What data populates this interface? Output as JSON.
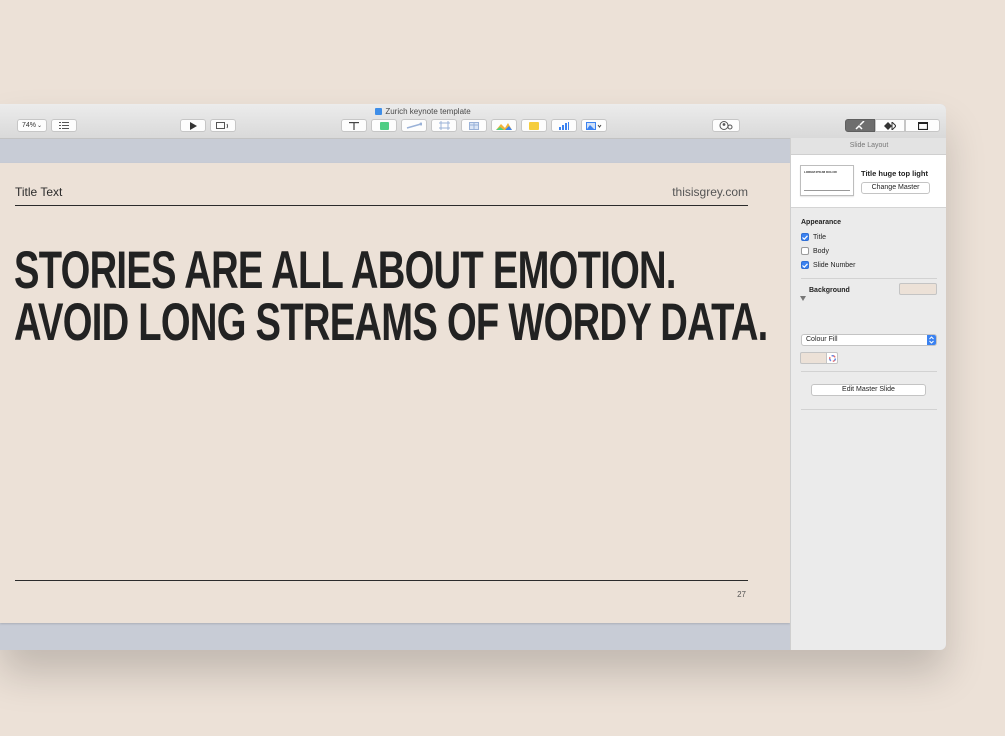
{
  "window": {
    "doc_title": "Zurich keynote template"
  },
  "toolbar": {
    "zoom_value": "74%",
    "icons": [
      "view-list-icon",
      "play-icon",
      "keynote-live-icon",
      "text-icon",
      "shape-icon",
      "connection-icon",
      "transform-icon",
      "table-icon",
      "chart-icon",
      "comment-icon",
      "bar-chart-icon",
      "media-icon",
      "collaborate-icon",
      "format-icon",
      "animate-icon",
      "document-icon"
    ]
  },
  "slide": {
    "title_text": "Title Text",
    "site": "thisisgrey.com",
    "headline_line1": "STORIES ARE ALL ABOUT EMOTION.",
    "headline_line2": "AVOID LONG STREAMS OF WORDY DATA.",
    "page_number": "27"
  },
  "inspector": {
    "header": "Slide Layout",
    "master_name": "Title huge top light",
    "change_master_label": "Change Master",
    "thumb_text": "LOREM IPSUM DOLOR",
    "appearance_label": "Appearance",
    "checkboxes": [
      {
        "label": "Title",
        "checked": true
      },
      {
        "label": "Body",
        "checked": false
      },
      {
        "label": "Slide Number",
        "checked": true
      }
    ],
    "background_label": "Background",
    "fill_option": "Colour Fill",
    "fill_color": "#ece1d7",
    "edit_master_label": "Edit Master Slide"
  },
  "colors": {
    "accent": "#3b82f0",
    "slide_bg": "#ece1d7",
    "canvas_bg": "#c8ccd6"
  }
}
